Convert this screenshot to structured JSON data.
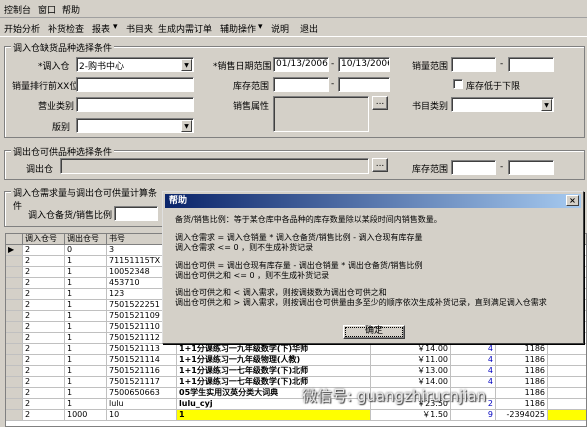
{
  "menu": [
    "控制台",
    "窗口",
    "帮助"
  ],
  "toolbar": [
    "开始分析",
    "补货检查",
    "报表",
    "书目夹",
    "生成内需订单",
    "辅助操作",
    "说明",
    "退出"
  ],
  "group_in": {
    "title": "调入仓缺货品种选择条件",
    "warehouse_label": "*调入仓",
    "warehouse_value": "2-购书中心",
    "sales_date_label": "*销售日期范围",
    "date_from": "01/13/2006",
    "date_sep": "-",
    "date_to": "10/13/2006",
    "sales_range_label": "销量范围",
    "sales_range_sep": "-",
    "rank_label": "销量排行前XX位",
    "stock_range_label": "库存范围",
    "stock_range_sep": "-",
    "low_stock_label": "库存低于下限",
    "category_label": "营业类别",
    "attr_label": "销售属性",
    "attr_btn": "...",
    "book_category_label": "书目类别",
    "edition_label": "版别"
  },
  "group_out": {
    "title": "调出仓可供品种选择条件",
    "warehouse_label": "调出仓",
    "btn": "...",
    "stock_range_label": "库存范围",
    "stock_range_sep": "-"
  },
  "group_calc": {
    "title": "调入仓需求量与调出仓可供量计算条件",
    "ratio_label": "调入仓备货/销售比例"
  },
  "grid": {
    "headers": [
      "调入仓号",
      "调出仓号",
      "书号"
    ],
    "rows": [
      {
        "in": "2",
        "out": "0",
        "isbn": "3",
        "title": "",
        "price": "",
        "q1": "",
        "q2": ""
      },
      {
        "in": "2",
        "out": "1",
        "isbn": "71151115TX",
        "title": "",
        "price": "",
        "q1": "",
        "q2": ""
      },
      {
        "in": "2",
        "out": "1",
        "isbn": "10052348",
        "title": "",
        "price": "",
        "q1": "",
        "q2": ""
      },
      {
        "in": "2",
        "out": "1",
        "isbn": "453710",
        "title": "",
        "price": "",
        "q1": "",
        "q2": ""
      },
      {
        "in": "2",
        "out": "1",
        "isbn": "123",
        "title": "",
        "price": "",
        "q1": "",
        "q2": ""
      },
      {
        "in": "2",
        "out": "1",
        "isbn": "7501522251",
        "title": "",
        "price": "",
        "q1": "",
        "q2": ""
      },
      {
        "in": "2",
        "out": "1",
        "isbn": "7501521109",
        "title": "",
        "price": "",
        "q1": "",
        "q2": ""
      },
      {
        "in": "2",
        "out": "1",
        "isbn": "7501521110",
        "title": "",
        "price": "",
        "q1": "",
        "q2": ""
      },
      {
        "in": "2",
        "out": "1",
        "isbn": "7501521112",
        "title": "",
        "price": "",
        "q1": "",
        "q2": ""
      },
      {
        "in": "2",
        "out": "1",
        "isbn": "7501521113",
        "title": "1+1分课练习一九年级数学(下)华师",
        "price": "￥14.00",
        "q1": "4",
        "q2": "1186"
      },
      {
        "in": "2",
        "out": "1",
        "isbn": "7501521114",
        "title": "1+1分课练习一九年级物理(人教)",
        "price": "￥11.00",
        "q1": "4",
        "q2": "1186"
      },
      {
        "in": "2",
        "out": "1",
        "isbn": "7501521116",
        "title": "1+1分课练习一七年级数学(下)北师",
        "price": "￥13.00",
        "q1": "4",
        "q2": "1186"
      },
      {
        "in": "2",
        "out": "1",
        "isbn": "7501521117",
        "title": "1+1分课练习一七年级数学(下)北师",
        "price": "￥14.00",
        "q1": "4",
        "q2": "1186"
      },
      {
        "in": "2",
        "out": "1",
        "isbn": "7500650663",
        "title": "05学生实用汉英分类大词典",
        "price": "",
        "q1": "",
        "q2": "1186"
      },
      {
        "in": "2",
        "out": "1",
        "isbn": "lulu",
        "title": "lulu_cyj",
        "price": "￥23.50",
        "q1": "2",
        "q2": "1186"
      },
      {
        "in": "2",
        "out": "1000",
        "isbn": "10",
        "title": "1",
        "price": "￥1.50",
        "q1": "9",
        "q2": "-2394025"
      }
    ]
  },
  "dialog": {
    "title": "帮助",
    "close": "×",
    "lines": [
      "备货/销售比例：等于某仓库中各品种的库存数量除以某段时间内销售数量。",
      "调入仓需求 = 调入仓销量 * 调入仓备货/销售比例 - 调入仓现有库存量",
      "调入仓需求 <= 0 ，则不生成补货记录",
      "调出仓可供 = 调出仓现有库存量 - 调出仓销量 * 调出仓备货/销售比例",
      "调出仓可供之和 <= 0 ，则不生成补货记录",
      "调出仓可供之和 < 调入需求，则按调拨数为调出仓可供之和",
      "调出仓可供之和 > 调入需求，则按调出仓可供量由多至少的顺序依次生成补货记录，直到满足调入仓需求"
    ],
    "ok": "确定"
  },
  "watermark": "微信号: guangzhirucnjian"
}
